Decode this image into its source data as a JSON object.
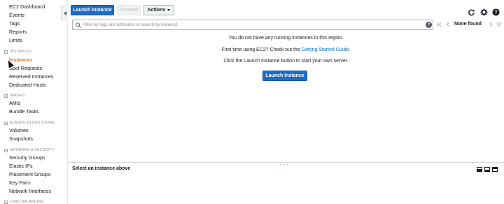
{
  "sidebar": {
    "top_items": [
      "EC2 Dashboard",
      "Events",
      "Tags",
      "Reports",
      "Limits"
    ],
    "sections": [
      {
        "title": "INSTANCES",
        "items": [
          "Instances",
          "Spot Requests",
          "Reserved Instances",
          "Dedicated Hosts"
        ],
        "active": "Instances"
      },
      {
        "title": "IMAGES",
        "items": [
          "AMIs",
          "Bundle Tasks"
        ]
      },
      {
        "title": "ELASTIC BLOCK STORE",
        "items": [
          "Volumes",
          "Snapshots"
        ]
      },
      {
        "title": "NETWORK & SECURITY",
        "items": [
          "Security Groups",
          "Elastic IPs",
          "Placement Groups",
          "Key Pairs",
          "Network Interfaces"
        ]
      },
      {
        "title": "LOAD BALANCING",
        "items": []
      }
    ]
  },
  "toolbar": {
    "launch_label": "Launch Instance",
    "connect_label": "Connect",
    "actions_label": "Actions",
    "icons": [
      "refresh-icon",
      "gear-icon",
      "help-icon"
    ]
  },
  "search": {
    "placeholder": "Filter by tags and attributes or search by keyword",
    "value": "",
    "pager_status": "None found"
  },
  "empty_state": {
    "line1": "You do not have any running instances in this region.",
    "line2_prefix": "First time using EC2? Check out the",
    "line2_link": "Getting Started Guide",
    "line2_suffix": ".",
    "line3": "Click the Launch Instance button to start your own server.",
    "launch_label": "Launch Instance"
  },
  "details": {
    "title": "Select an instance above"
  },
  "colors": {
    "primary": "#1f6cc5",
    "active_nav": "#ec7211",
    "link": "#0073bb"
  }
}
